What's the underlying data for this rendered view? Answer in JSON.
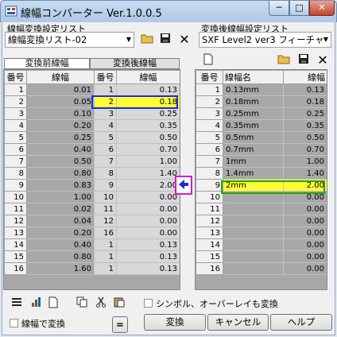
{
  "window": {
    "title": "線幅コンバーター Ver.1.0.0.5",
    "min_label": "─",
    "max_label": "□",
    "close_label": "✕"
  },
  "left": {
    "list_label": "線幅変換設定リスト",
    "combo_value": "線幅変換リスト-02",
    "tab_before": "変換前線幅",
    "tab_after": "変換後線幅",
    "headers": [
      "番号",
      "線幅",
      "番号",
      "線幅"
    ],
    "rows": [
      [
        "1",
        "0.01",
        "1",
        "0.13"
      ],
      [
        "2",
        "0.05",
        "2",
        "0.18"
      ],
      [
        "3",
        "0.10",
        "3",
        "0.25"
      ],
      [
        "4",
        "0.20",
        "4",
        "0.35"
      ],
      [
        "5",
        "0.25",
        "5",
        "0.50"
      ],
      [
        "6",
        "0.40",
        "6",
        "0.70"
      ],
      [
        "7",
        "0.50",
        "7",
        "1.00"
      ],
      [
        "8",
        "0.80",
        "8",
        "1.40"
      ],
      [
        "9",
        "0.83",
        "9",
        "2.00"
      ],
      [
        "10",
        "1.00",
        "10",
        "0.00"
      ],
      [
        "11",
        "0.02",
        "11",
        "0.00"
      ],
      [
        "12",
        "0.04",
        "12",
        "0.00"
      ],
      [
        "13",
        "0.20",
        "16",
        "0.00"
      ],
      [
        "14",
        "0.40",
        "1",
        "0.13"
      ],
      [
        "15",
        "0.80",
        "1",
        "0.13"
      ],
      [
        "16",
        "1.60",
        "1",
        "0.13"
      ]
    ]
  },
  "right": {
    "list_label": "変換後線幅設定リスト",
    "combo_value": "SXF Level2 ver3 フィーチャ",
    "headers": [
      "番号",
      "線幅名",
      "線幅"
    ],
    "rows": [
      [
        "1",
        "0.13mm",
        "0.13"
      ],
      [
        "2",
        "0.18mm",
        "0.18"
      ],
      [
        "3",
        "0.25mm",
        "0.25"
      ],
      [
        "4",
        "0.35mm",
        "0.35"
      ],
      [
        "5",
        "0.5mm",
        "0.50"
      ],
      [
        "6",
        "0.7mm",
        "0.70"
      ],
      [
        "7",
        "1mm",
        "1.00"
      ],
      [
        "8",
        "1.4mm",
        "1.40"
      ],
      [
        "9",
        "2mm",
        "2.00"
      ],
      [
        "10",
        "",
        "0.00"
      ],
      [
        "11",
        "",
        "0.00"
      ],
      [
        "12",
        "",
        "0.00"
      ],
      [
        "13",
        "",
        "0.00"
      ],
      [
        "14",
        "",
        "0.00"
      ],
      [
        "15",
        "",
        "0.00"
      ],
      [
        "16",
        "",
        "0.00"
      ]
    ]
  },
  "footer": {
    "symbol_overlay_label": "シンボル、オーバーレイも変換",
    "convert_by_width_label": "線幅で変換",
    "equals_label": "=",
    "convert_button": "変換",
    "cancel_button": "キャンセル",
    "help_button": "ヘルプ"
  },
  "icons": {
    "transfer_arrow": "←"
  }
}
